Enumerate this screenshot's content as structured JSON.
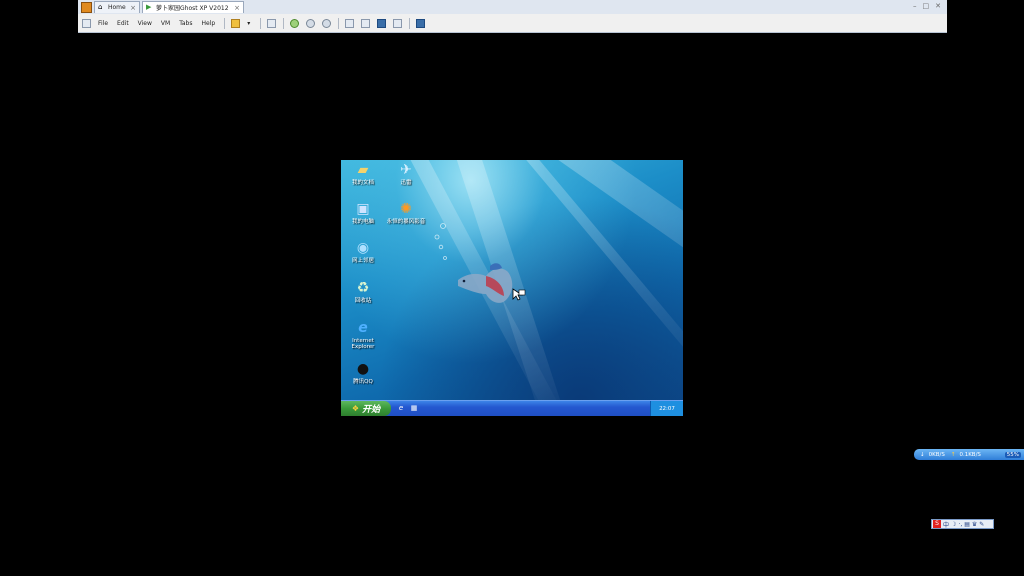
{
  "vmware": {
    "tabs": [
      {
        "label": "Home"
      },
      {
        "label": "萝卜家园Ghost XP V2012"
      }
    ],
    "menu": [
      "File",
      "Edit",
      "View",
      "VM",
      "Tabs",
      "Help"
    ],
    "window_controls": [
      "–",
      "□",
      "✕"
    ],
    "tab_close": "×"
  },
  "guest": {
    "desktop_icons": [
      {
        "label": "我的文档",
        "icon": "folder-icon"
      },
      {
        "label": "迅雷",
        "icon": "thunder-bird-icon"
      },
      {
        "label": "我的电脑",
        "icon": "computer-icon"
      },
      {
        "label": "永恒的暴风影音",
        "icon": "media-player-icon"
      },
      {
        "label": "网上邻居",
        "icon": "network-icon"
      },
      {
        "label": "回收站",
        "icon": "recycle-bin-icon"
      },
      {
        "label": "Internet Explorer",
        "icon": "ie-icon"
      },
      {
        "label": "腾讯QQ",
        "icon": "qq-penguin-icon"
      }
    ],
    "taskbar": {
      "start_label": "开始",
      "clock": "22:07"
    }
  },
  "host": {
    "net_monitor": {
      "down": "0KB/S",
      "up": "0.1KB/S",
      "percent": "55%"
    },
    "ime_bar": {
      "logo": "S",
      "label": "中"
    }
  },
  "colors": {
    "xp_taskbar": "#2458d0",
    "xp_start": "#3a9a3a",
    "desktop_top": "#3fb8de",
    "desktop_bottom": "#0c4d8e"
  }
}
